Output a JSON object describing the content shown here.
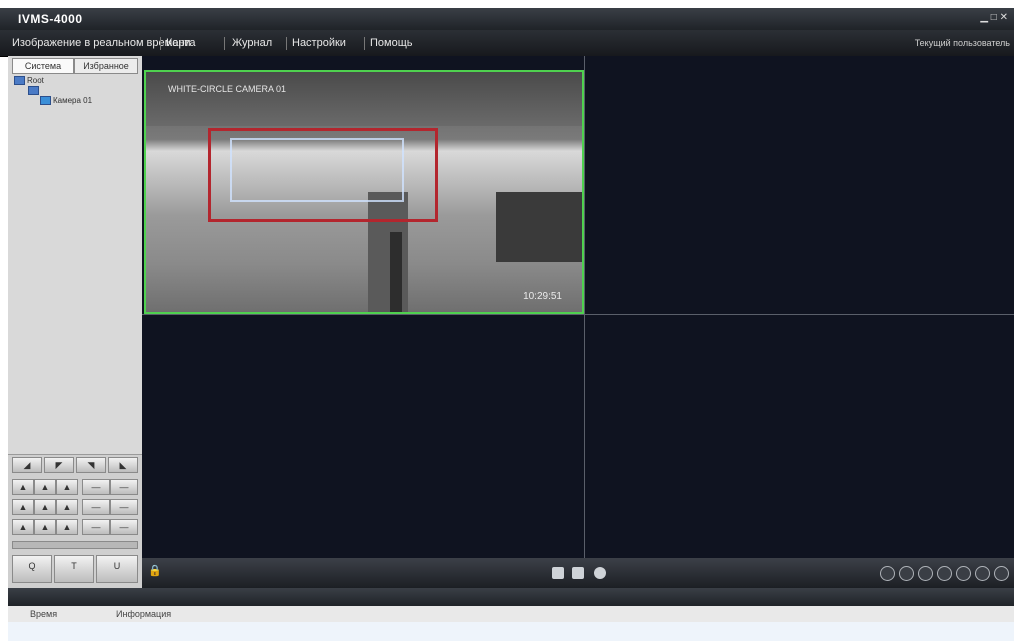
{
  "window": {
    "title": "IVMS-4000",
    "controls": "▁ □ ✕"
  },
  "menu": {
    "items": [
      "Изображение в реальном времени",
      "Карта",
      "Журнал",
      "Настройки",
      "Помощь"
    ],
    "user_label": "Текущий пользователь"
  },
  "left_panel": {
    "tabs": [
      "Система",
      "Избранное"
    ],
    "tree": {
      "root": "Root",
      "device": "",
      "camera": "Камера 01"
    },
    "ptz_rows": [
      [
        "◢",
        "◤",
        "◥",
        "◣"
      ],
      [
        "▲",
        "▲",
        "▲",
        "—",
        "—"
      ],
      [
        "▲",
        "▲",
        "▲",
        "—",
        "—"
      ],
      [
        "▲",
        "▲",
        "▲",
        "—",
        "—"
      ]
    ],
    "ptz_bottom": [
      "Q",
      "T",
      "U"
    ]
  },
  "video": {
    "osd_text": "WHITE-CIRCLE CAMERA 01",
    "timestamp": "10:29:51",
    "border_color": "#4fd14f",
    "roi_color": "#b3262e"
  },
  "log": {
    "columns": [
      "Время",
      "Информация"
    ]
  },
  "icons": {
    "lock": "lock-icon",
    "snapshot": "snapshot-icon",
    "record": "record-icon",
    "audio": "audio-icon"
  }
}
